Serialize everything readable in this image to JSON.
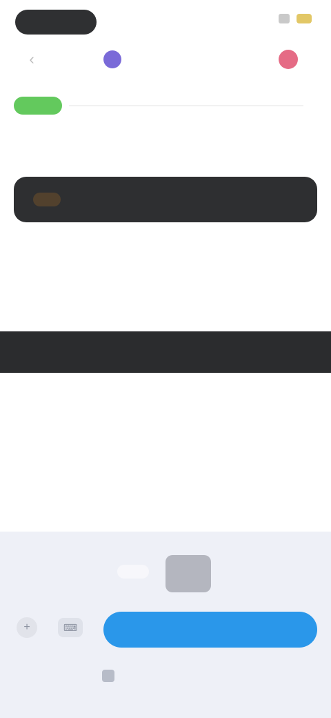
{
  "status_bar": {
    "time": "",
    "signal_icon": "signal-icon",
    "battery_icon": "battery-icon"
  },
  "nav": {
    "back_icon": "chevron-left-icon",
    "account_label": "",
    "middle_label": "",
    "badge_color": "#e56b85"
  },
  "content": {
    "badge_label": "",
    "heading": "",
    "dark_card_text": "",
    "line1": "",
    "line2": "",
    "dark_strip_text": ""
  },
  "composer": {
    "primary_button_label": "",
    "disclaimer": "",
    "left_icons": [
      "attachment-icon",
      "keyboard-icon"
    ]
  },
  "colors": {
    "accent": "#2a97ea",
    "purple": "#7a6ad8",
    "green": "#63c95d",
    "dark": "#2e2f31"
  }
}
